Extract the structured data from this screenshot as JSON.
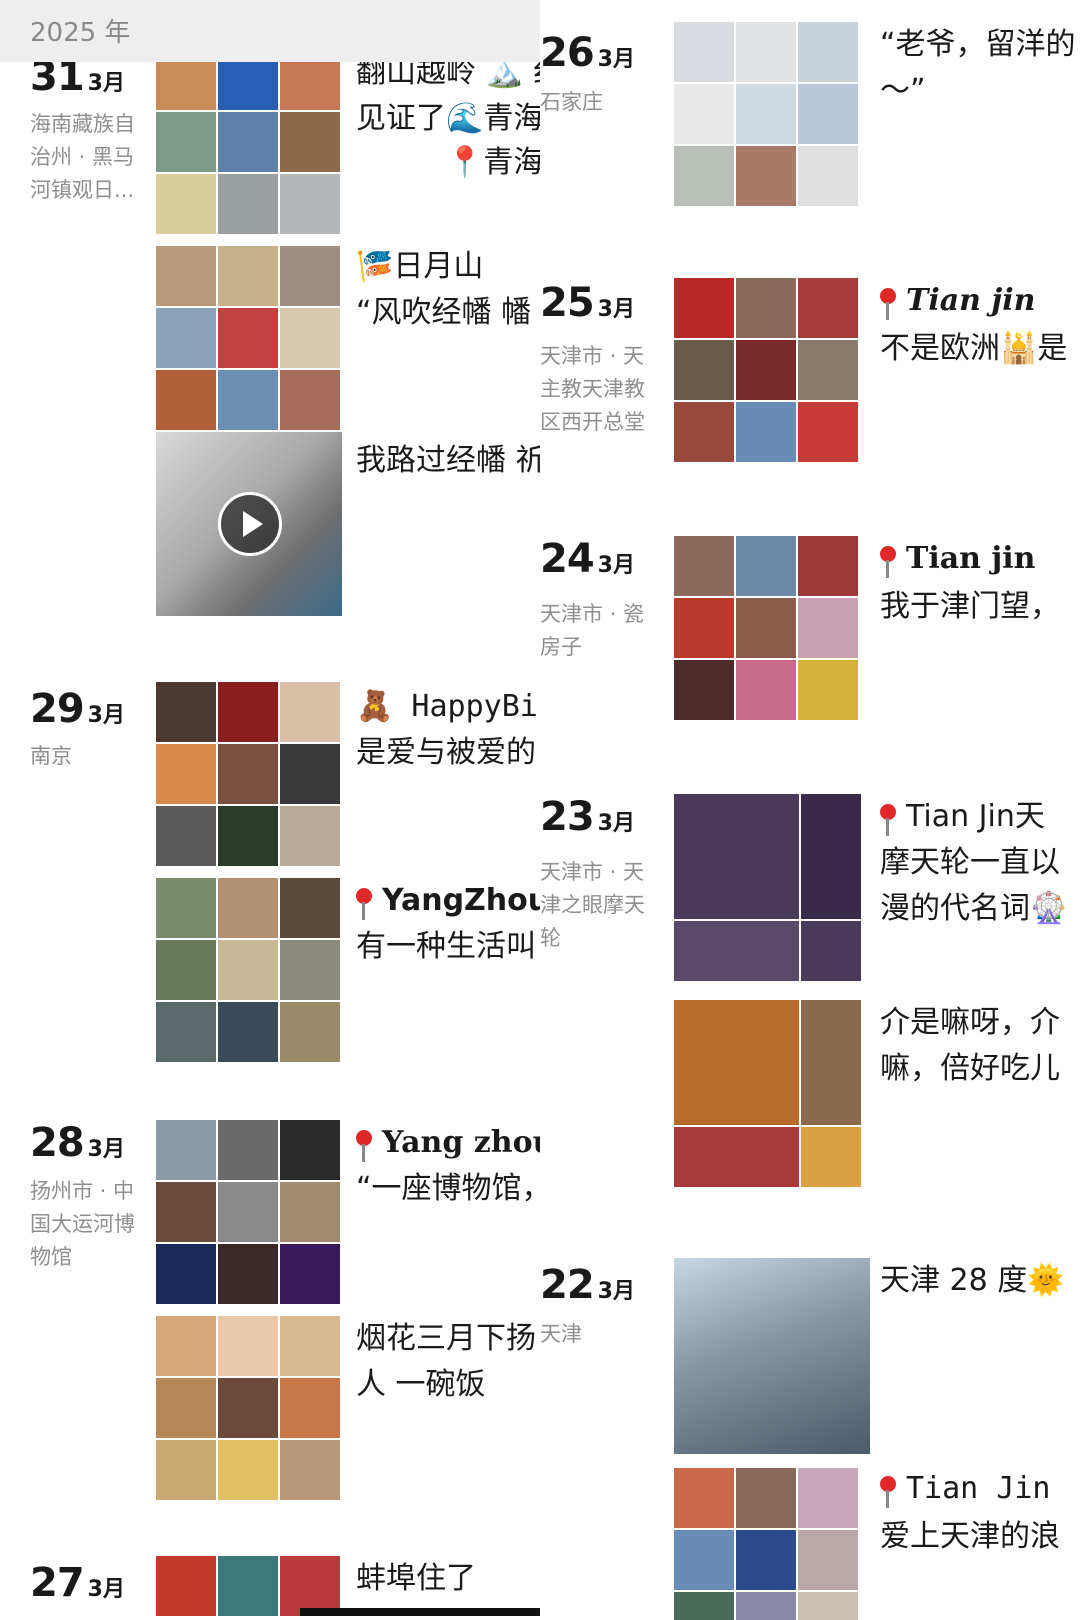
{
  "year_label": "2025 年",
  "colors": {
    "accent_pin": "#e02828",
    "text": "#1a1a1a",
    "muted": "#8f8f8f",
    "year_bar_bg": "#eeeeee"
  },
  "left": [
    {
      "day": "31",
      "month": "3月",
      "location": "海南藏族自治州 · 黑马河镇观日...",
      "captions": [
        "翻山越岭 🏔️ 纟",
        "见证了🌊青海",
        "📍青海"
      ]
    },
    {
      "captions": [
        "🎏日月山",
        "“风吹经幡 幡"
      ]
    },
    {
      "captions": [
        "我路过经幡 祈"
      ]
    },
    {
      "day": "29",
      "month": "3月",
      "location": "南京",
      "captions": [
        "🧸 HappyBirthda",
        "是爱与被爱的"
      ]
    },
    {
      "captions": [
        "YangZhou",
        "有一种生活叫"
      ]
    },
    {
      "day": "28",
      "month": "3月",
      "location": "扬州市 · 中国大运河博物馆",
      "captions": [
        "Yang zhou",
        "“一座博物馆，"
      ]
    },
    {
      "captions": [
        "烟花三月下扬",
        "人 一碗饭"
      ]
    },
    {
      "day": "27",
      "month": "3月",
      "captions": [
        "蚌埠住了"
      ]
    }
  ],
  "right": [
    {
      "day": "26",
      "month": "3月",
      "location": "石家庄",
      "captions": [
        "“老爷，留洋的",
        "～”"
      ]
    },
    {
      "day": "25",
      "month": "3月",
      "location": "天津市 · 天主教天津教区西开总堂",
      "captions": [
        "Tian jin",
        "不是欧洲🕌是"
      ]
    },
    {
      "day": "24",
      "month": "3月",
      "location": "天津市 · 瓷房子",
      "captions": [
        "Tian jin",
        "我于津门望，"
      ]
    },
    {
      "day": "23",
      "month": "3月",
      "location": "天津市 · 天津之眼摩天轮",
      "captions": [
        "Tian Jin天",
        "摩天轮一直以",
        "漫的代名词🎡"
      ]
    },
    {
      "captions": [
        "介是嘛呀，介",
        "嘛，倍好吃儿"
      ]
    },
    {
      "day": "22",
      "month": "3月",
      "location": "天津",
      "captions": [
        "天津 28 度🌞"
      ]
    },
    {
      "captions": [
        "Tian Jin",
        "爱上天津的浪"
      ]
    }
  ]
}
